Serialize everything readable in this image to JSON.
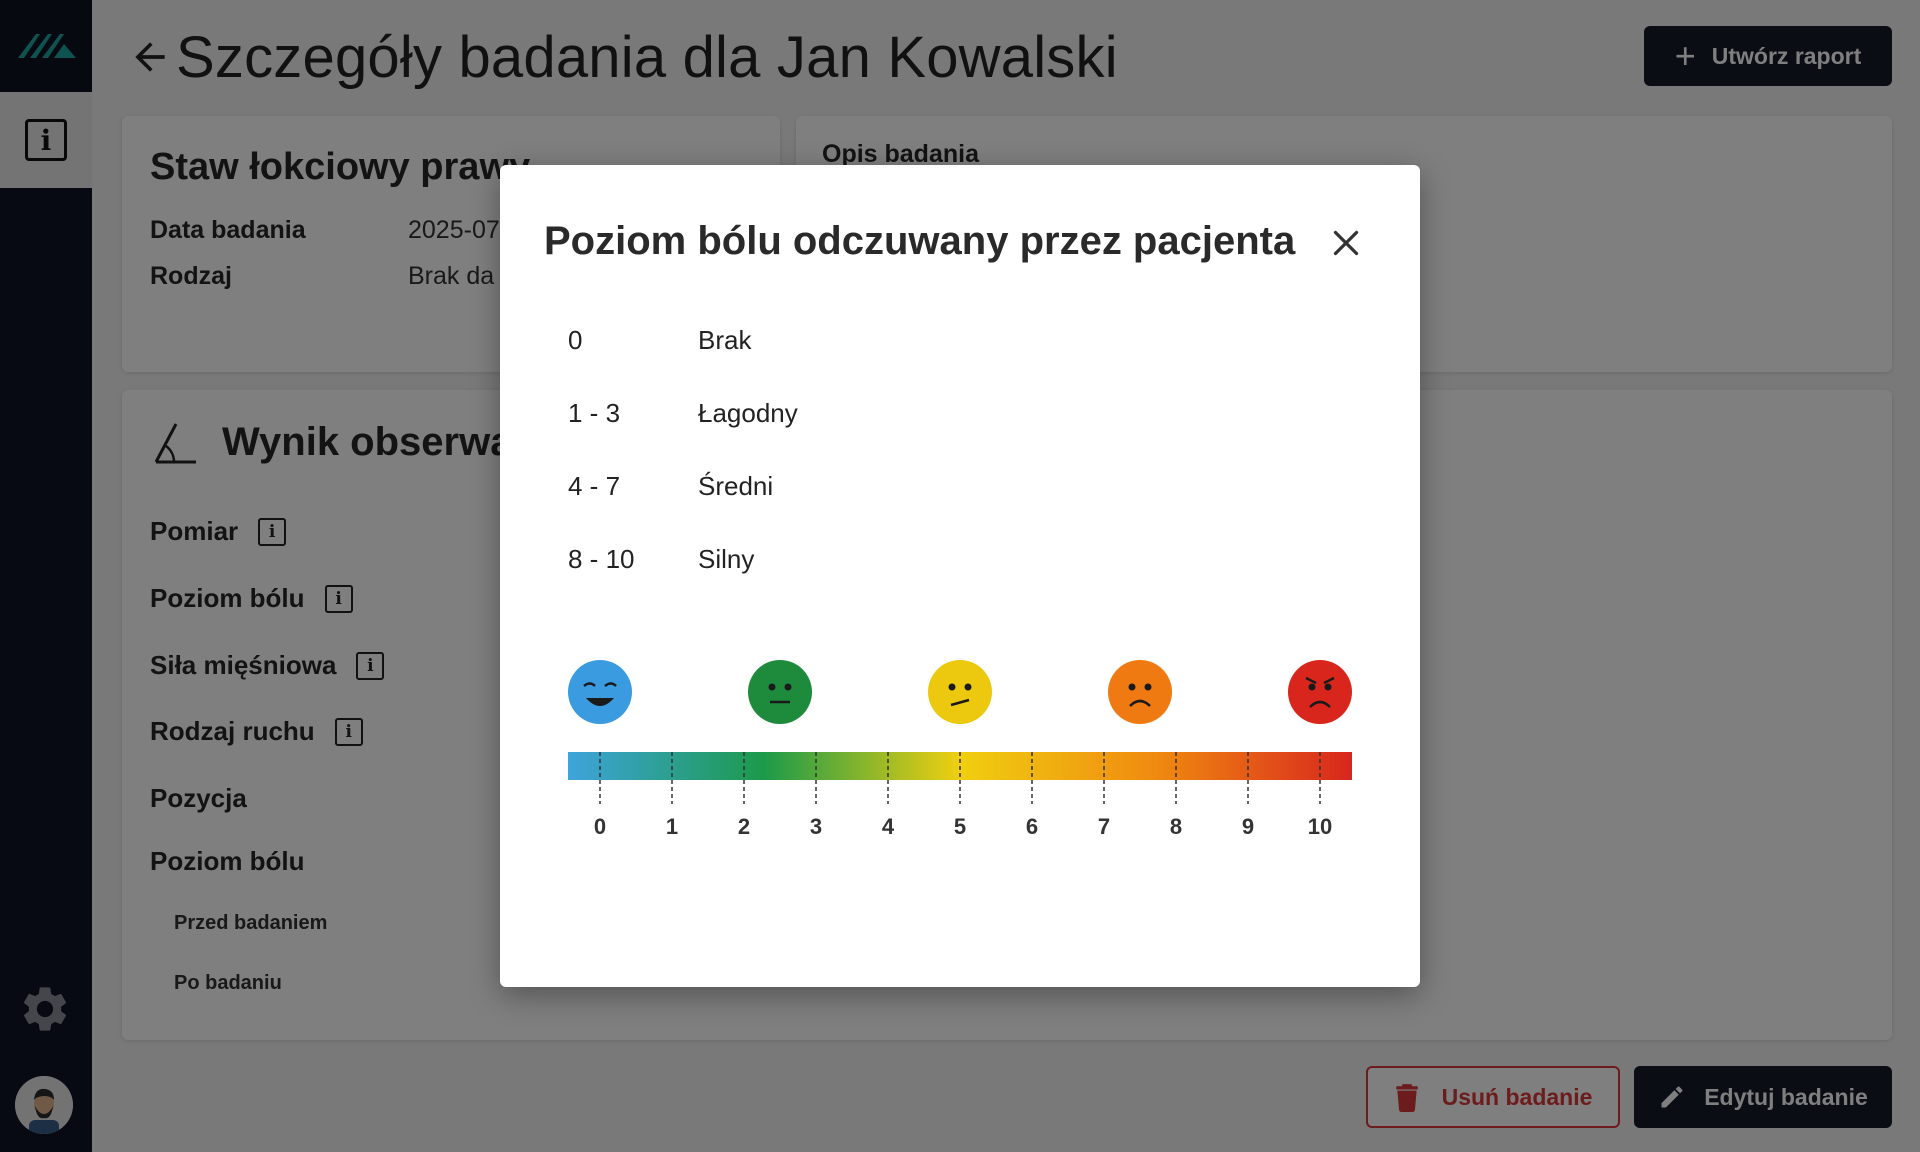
{
  "header": {
    "title": "Szczegóły badania dla Jan Kowalski",
    "create_report": "Utwórz raport"
  },
  "exam_card": {
    "title": "Staw łokciowy prawy",
    "date_label": "Data badania",
    "date_value": "2025-07",
    "type_label": "Rodzaj",
    "type_value": "Brak da"
  },
  "description_card": {
    "label": "Opis badania"
  },
  "observation": {
    "title": "Wynik obserwa",
    "rows": [
      "Pomiar",
      "Poziom bólu",
      "Siła mięśniowa",
      "Rodzaj ruchu",
      "Pozycja",
      "Poziom bólu"
    ],
    "sub_rows": [
      "Przed badaniem",
      "Po badaniu"
    ]
  },
  "actions": {
    "delete": "Usuń badanie",
    "edit": "Edytuj badanie"
  },
  "modal": {
    "title": "Poziom bólu odczuwany przez pacjenta",
    "scale": [
      {
        "range": "0",
        "label": "Brak"
      },
      {
        "range": "1 - 3",
        "label": "Łagodny"
      },
      {
        "range": "4 - 7",
        "label": "Średni"
      },
      {
        "range": "8 - 10",
        "label": "Silny"
      }
    ],
    "ticks": [
      "0",
      "1",
      "2",
      "3",
      "4",
      "5",
      "6",
      "7",
      "8",
      "9",
      "10"
    ],
    "faces": [
      {
        "name": "face-very-happy-icon",
        "color": "#3b9be0"
      },
      {
        "name": "face-neutral-icon",
        "color": "#1e8a3c"
      },
      {
        "name": "face-unsure-icon",
        "color": "#ecc90f"
      },
      {
        "name": "face-sad-icon",
        "color": "#f07a12"
      },
      {
        "name": "face-angry-icon",
        "color": "#d9261c"
      }
    ],
    "gradient": [
      "#3ea4dc",
      "#1c9a4a",
      "#f0cf10",
      "#f08a10",
      "#d8261e"
    ]
  }
}
